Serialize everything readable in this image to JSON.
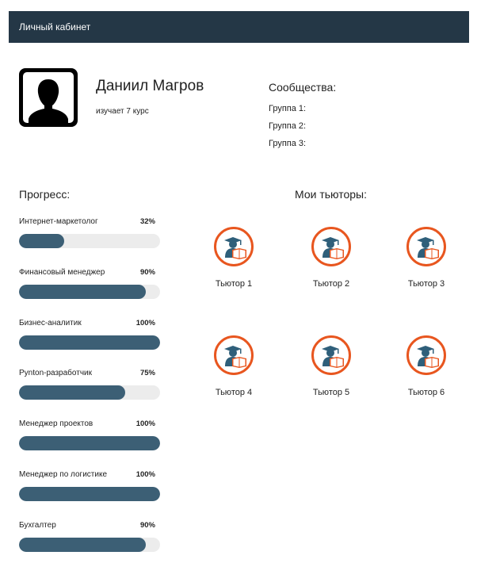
{
  "header": {
    "title": "Личный кабинет"
  },
  "profile": {
    "name": "Даниил Магров",
    "course": "изучает 7 курс"
  },
  "communities": {
    "title": "Сообщества:",
    "groups": [
      "Группа 1:",
      "Группа 2:",
      "Группа 3:"
    ]
  },
  "progress": {
    "title": "Прогресс:",
    "items": [
      {
        "label": "Интернет-маркетолог",
        "value": "32%",
        "fraction": 0.32
      },
      {
        "label": "Финансовый менеджер",
        "value": "90%",
        "fraction": 0.9
      },
      {
        "label": "Бизнес-аналитик",
        "value": "100%",
        "fraction": 1.0
      },
      {
        "label": "Pynton-разработчик",
        "value": "75%",
        "fraction": 0.75
      },
      {
        "label": "Менеджер проектов",
        "value": "100%",
        "fraction": 1.0
      },
      {
        "label": "Менеджер по логистике",
        "value": "100%",
        "fraction": 1.0
      },
      {
        "label": "Бухгалтер",
        "value": "90%",
        "fraction": 0.9
      }
    ],
    "fill_color": "#3c5f75",
    "track_color": "#ececec"
  },
  "tutors": {
    "title": "Мои тьюторы:",
    "items": [
      {
        "label": "Тьютор 1",
        "icon": "tutor-icon"
      },
      {
        "label": "Тьютор 2",
        "icon": "tutor-icon"
      },
      {
        "label": "Тьютор 3",
        "icon": "tutor-icon"
      },
      {
        "label": "Тьютор 4",
        "icon": "tutor-icon"
      },
      {
        "label": "Тьютор 5",
        "icon": "tutor-icon"
      },
      {
        "label": "Тьютор 6",
        "icon": "tutor-icon"
      }
    ],
    "accent_color": "#e8561f"
  },
  "colors": {
    "header_bg": "#243746",
    "header_text": "#ffffff"
  }
}
